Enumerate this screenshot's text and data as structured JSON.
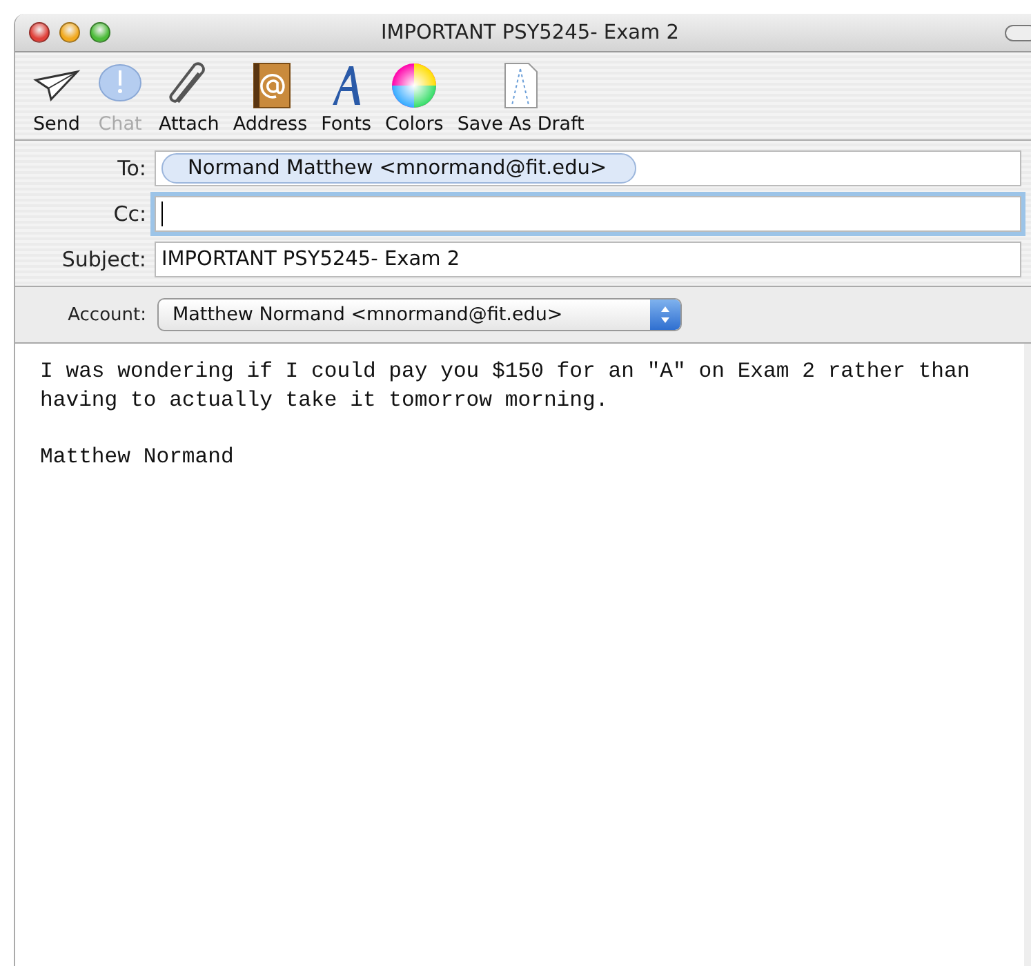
{
  "window": {
    "title": "IMPORTANT PSY5245- Exam 2"
  },
  "toolbar": [
    {
      "label": "Send",
      "kind": "send",
      "disabled": false
    },
    {
      "label": "Chat",
      "kind": "chat",
      "disabled": true
    },
    {
      "label": "Attach",
      "kind": "attach",
      "disabled": false
    },
    {
      "label": "Address",
      "kind": "address",
      "disabled": false
    },
    {
      "label": "Fonts",
      "kind": "fonts",
      "disabled": false
    },
    {
      "label": "Colors",
      "kind": "colors",
      "disabled": false
    },
    {
      "label": "Save As Draft",
      "kind": "draft",
      "disabled": false
    }
  ],
  "header": {
    "to": {
      "label": "To:",
      "recipients": [
        "Normand Matthew <mnormand@fit.edu>"
      ]
    },
    "cc": {
      "label": "Cc:",
      "focused": true
    },
    "subject": {
      "label": "Subject:",
      "value": "IMPORTANT PSY5245- Exam 2"
    },
    "account": {
      "label": "Account:",
      "value": "Matthew Normand <mnormand@fit.edu>"
    }
  },
  "body": {
    "paragraphs": [
      [
        "I was wondering if I could pay you $150 for an \"A\" on Exam 2 rather than",
        "having to actually take it tomorrow morning."
      ],
      [
        "Matthew Normand"
      ]
    ]
  }
}
